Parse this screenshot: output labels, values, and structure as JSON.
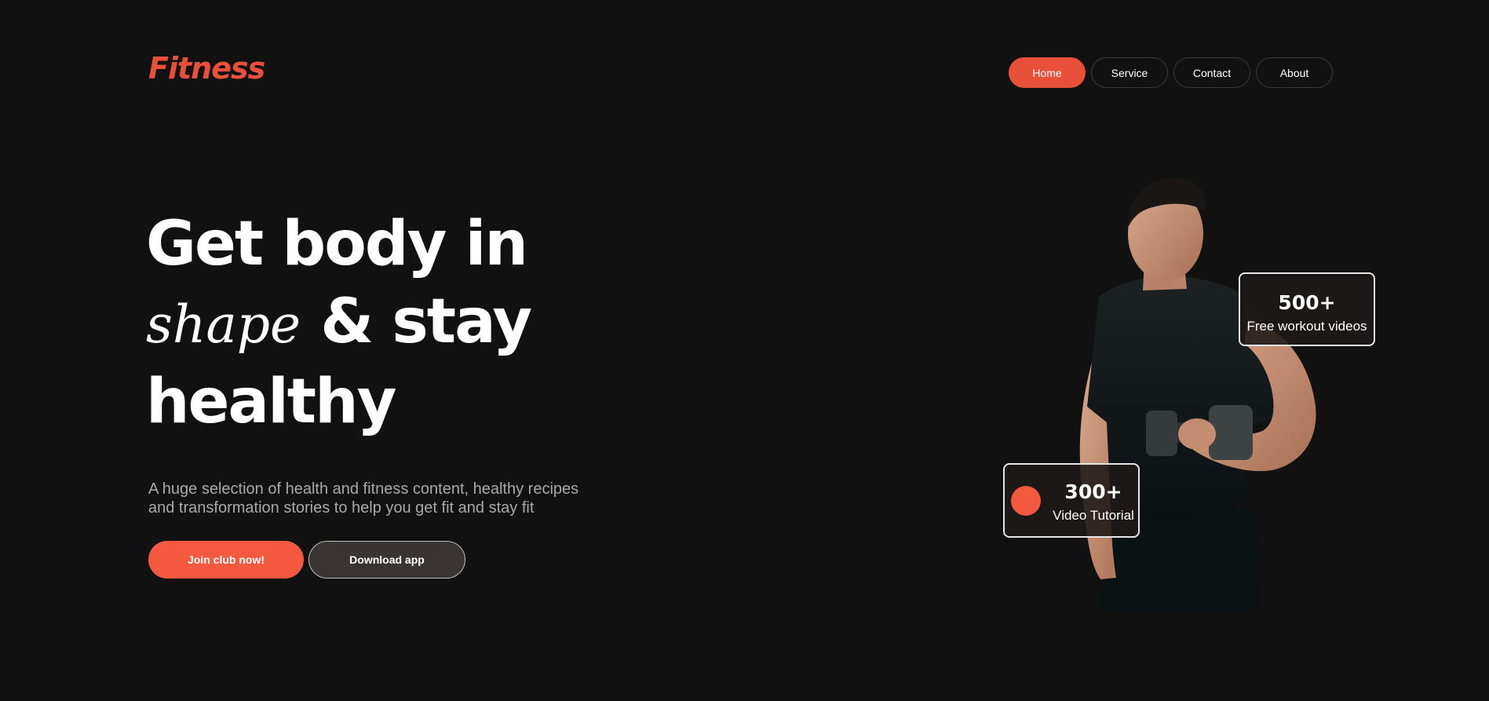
{
  "brand": {
    "logo": "Fitness",
    "accent_color": "#e8503a"
  },
  "nav": {
    "items": [
      {
        "label": "Home",
        "active": true
      },
      {
        "label": "Service",
        "active": false
      },
      {
        "label": "Contact",
        "active": false
      },
      {
        "label": "About",
        "active": false
      }
    ]
  },
  "hero": {
    "headline_line1": "Get body in",
    "headline_script": "shape",
    "headline_line2_rest": " & stay",
    "headline_line3": "healthy",
    "subtitle_line1": "A huge selection of health and fitness content, healthy recipes",
    "subtitle_line2": "and transformation stories to help you get fit and stay fit",
    "cta_primary": "Join club now!",
    "cta_secondary": "Download app",
    "image_icon": "athlete-with-dumbbell-photo"
  },
  "stats": {
    "videos": {
      "value": "500+",
      "label": "Free workout videos"
    },
    "tutorials": {
      "value": "300+",
      "label": "Video Tutorial"
    }
  },
  "colors": {
    "background": "#111111",
    "primary_button": "#f4593f",
    "secondary_button": "#3a3434",
    "subtitle_text": "#a9a9a9"
  }
}
